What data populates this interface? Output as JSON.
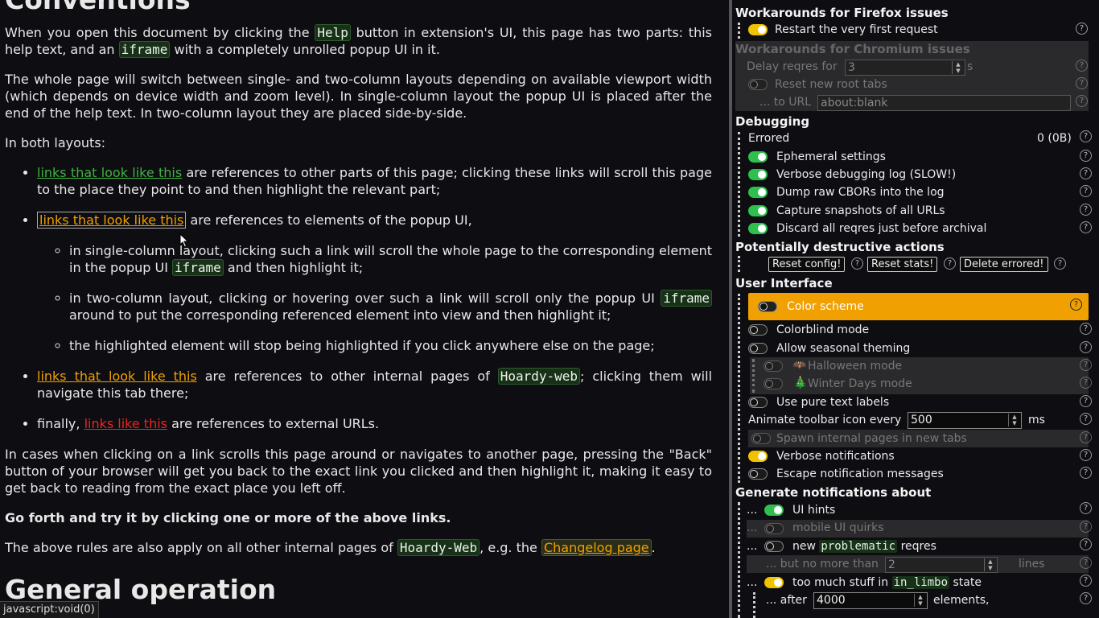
{
  "help": {
    "heading_conventions": "Conventions",
    "p1_a": "When you open this document by clicking the ",
    "p1_code1": "Help",
    "p1_b": " button in extension's UI, this page has two parts: this help text, and an ",
    "p1_code2": "iframe",
    "p1_c": " with a completely unrolled popup UI in it.",
    "p2": "The whole page will switch between single- and two-column layouts depending on available viewport width (which depends on device width and zoom level). In single-column layout the popup UI is placed after the end of the help text. In two-column layout they are placed side-by-side.",
    "p3": "In both layouts:",
    "li1_link": "links that look like this",
    "li1_text": " are references to other parts of this page; clicking these links will scroll this page to the place they point to and then highlight the relevant part;",
    "li2_link": "links that look like this",
    "li2_text": " are references to elements of the popup UI,",
    "sub1_a": "in single-column layout, clicking such a link will scroll the whole page to the corresponding element in the popup UI ",
    "sub1_code": "iframe",
    "sub1_b": " and then highlight it;",
    "sub2_a": "in two-column layout, clicking or hovering over such a link will scroll only the popup UI ",
    "sub2_code": "iframe",
    "sub2_b": " around to put the corresponding referenced element into view and then highlight it;",
    "sub3": "the highlighted element will stop being highlighted if you click anywhere else on the page;",
    "li3_link": "links that look like this",
    "li3_a": " are references to other internal pages of ",
    "li3_code": "Hoardy-web",
    "li3_b": "; clicking them will navigate this tab there;",
    "li4_a": "finally, ",
    "li4_link": "links like this",
    "li4_b": " are references to external URLs.",
    "p4": "In cases when clicking on a link scrolls this page around or navigates to another page, pressing the \"Back\" button of your browser will get you back to the exact link you clicked and then highlight it, making it easy to get back to reading from the exact place you left off.",
    "p5": "Go forth and try it by clicking one or more of the above links.",
    "p6_a": "The above rules are also apply on all other internal pages of ",
    "p6_code": "Hoardy-Web",
    "p6_b": ", e.g. the ",
    "p6_link": "Changelog page",
    "p6_c": ".",
    "heading_general": "General operation"
  },
  "status_bar": "javascript:void(0)",
  "ui": {
    "help_glyph": "?",
    "firefox_hdr": "Workarounds for Firefox issues",
    "restart_first": "Restart the very first request",
    "chromium_hdr": "Workarounds for Chromium issues",
    "delay_label": "Delay reqres for",
    "delay_value": "3",
    "delay_unit": "s",
    "reset_root": "Reset new root tabs",
    "to_url_label": "... to URL",
    "to_url_value": "about:blank",
    "debug_hdr": "Debugging",
    "errored_label": "Errored",
    "errored_value": "0 (0B)",
    "ephemeral": "Ephemeral settings",
    "verbose_log": "Verbose debugging log (SLOW!)",
    "dump_cbor": "Dump raw CBORs into the log",
    "capture_snap": "Capture snapshots of all URLs",
    "discard_reqres": "Discard all reqres just before archival",
    "destructive_hdr": "Potentially destructive actions",
    "btn_reset_config": "Reset config!",
    "btn_reset_stats": "Reset stats!",
    "btn_delete_errored": "Delete errored!",
    "ui_hdr": "User Interface",
    "color_scheme": "Color scheme",
    "colorblind": "Colorblind mode",
    "seasonal": "Allow seasonal theming",
    "halloween": "Halloween mode",
    "winter": "Winter Days mode",
    "pure_text": "Use pure text labels",
    "animate_label": "Animate toolbar icon every",
    "animate_value": "500",
    "animate_unit": "ms",
    "spawn_internal": "Spawn internal pages in new tabs",
    "verbose_notif": "Verbose notifications",
    "escape_notif": "Escape notification messages",
    "gen_hdr": "Generate notifications about",
    "ellipsis": "...",
    "ui_hints": "UI hints",
    "mobile_quirks": "mobile UI quirks",
    "new_label": "new",
    "problematic": "problematic",
    "reqres_label": "reqres",
    "no_more_label": "... but no more than",
    "no_more_value": "2",
    "lines_unit": "lines",
    "too_much_a": "too much stuff in",
    "in_limbo": "in_limbo",
    "too_much_b": "state",
    "after_label": "... after",
    "after_value": "4000",
    "elements_unit": "elements,"
  }
}
